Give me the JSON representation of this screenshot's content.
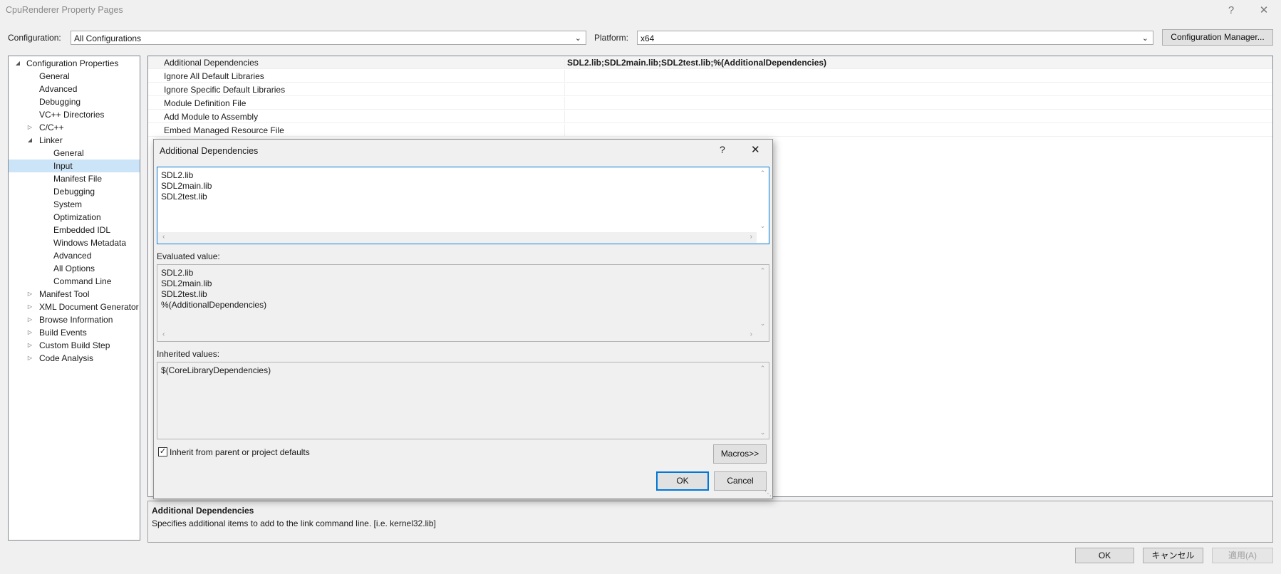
{
  "window": {
    "title": "CpuRenderer Property Pages",
    "help_glyph": "?",
    "close_glyph": "✕"
  },
  "toolbar": {
    "configuration_label": "Configuration:",
    "configuration_value": "All Configurations",
    "platform_label": "Platform:",
    "platform_value": "x64",
    "config_manager_button": "Configuration Manager..."
  },
  "tree": {
    "root": "Configuration Properties",
    "items": [
      {
        "label": "General",
        "level": 1
      },
      {
        "label": "Advanced",
        "level": 1
      },
      {
        "label": "Debugging",
        "level": 1
      },
      {
        "label": "VC++ Directories",
        "level": 1
      },
      {
        "label": "C/C++",
        "level": 1,
        "expander": "collapsed"
      },
      {
        "label": "Linker",
        "level": 1,
        "expander": "expanded"
      },
      {
        "label": "General",
        "level": 2
      },
      {
        "label": "Input",
        "level": 2,
        "selected": true
      },
      {
        "label": "Manifest File",
        "level": 2
      },
      {
        "label": "Debugging",
        "level": 2
      },
      {
        "label": "System",
        "level": 2
      },
      {
        "label": "Optimization",
        "level": 2
      },
      {
        "label": "Embedded IDL",
        "level": 2
      },
      {
        "label": "Windows Metadata",
        "level": 2
      },
      {
        "label": "Advanced",
        "level": 2
      },
      {
        "label": "All Options",
        "level": 2
      },
      {
        "label": "Command Line",
        "level": 2
      },
      {
        "label": "Manifest Tool",
        "level": 1,
        "expander": "collapsed"
      },
      {
        "label": "XML Document Generator",
        "level": 1,
        "expander": "collapsed"
      },
      {
        "label": "Browse Information",
        "level": 1,
        "expander": "collapsed"
      },
      {
        "label": "Build Events",
        "level": 1,
        "expander": "collapsed"
      },
      {
        "label": "Custom Build Step",
        "level": 1,
        "expander": "collapsed"
      },
      {
        "label": "Code Analysis",
        "level": 1,
        "expander": "collapsed"
      }
    ]
  },
  "properties": [
    {
      "name": "Additional Dependencies",
      "value": "SDL2.lib;SDL2main.lib;SDL2test.lib;%(AdditionalDependencies)"
    },
    {
      "name": "Ignore All Default Libraries",
      "value": ""
    },
    {
      "name": "Ignore Specific Default Libraries",
      "value": ""
    },
    {
      "name": "Module Definition File",
      "value": ""
    },
    {
      "name": "Add Module to Assembly",
      "value": ""
    },
    {
      "name": "Embed Managed Resource File",
      "value": ""
    }
  ],
  "description": {
    "title": "Additional Dependencies",
    "text": "Specifies additional items to add to the link command line. [i.e. kernel32.lib]"
  },
  "footer": {
    "ok": "OK",
    "cancel": "キャンセル",
    "apply": "適用(A)"
  },
  "dialog": {
    "title": "Additional Dependencies",
    "help_glyph": "?",
    "close_glyph": "✕",
    "edit_text": "SDL2.lib\nSDL2main.lib\nSDL2test.lib",
    "evaluated_label": "Evaluated value:",
    "evaluated_text": "SDL2.lib\nSDL2main.lib\nSDL2test.lib\n%(AdditionalDependencies)",
    "inherited_label": "Inherited values:",
    "inherited_text": "$(CoreLibraryDependencies)",
    "inherit_checkbox_label": "Inherit from parent or project defaults",
    "inherit_checked": true,
    "macros_button": "Macros>>",
    "ok_button": "OK",
    "cancel_button": "Cancel"
  }
}
